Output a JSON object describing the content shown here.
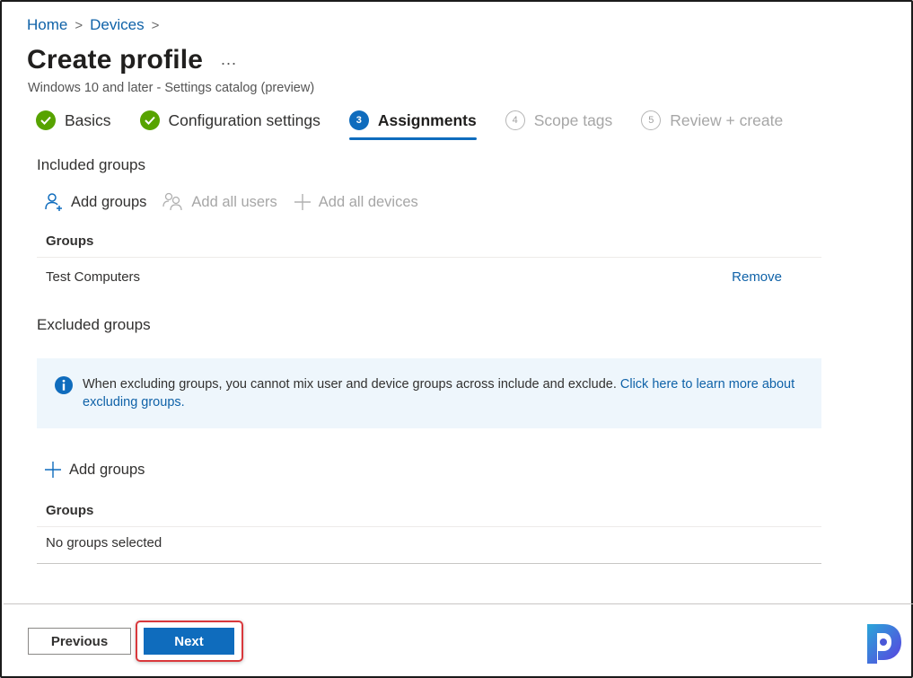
{
  "breadcrumb": [
    {
      "label": "Home"
    },
    {
      "label": "Devices"
    }
  ],
  "breadcrumb_separator": ">",
  "page": {
    "title": "Create profile",
    "more_label": "...",
    "subtitle": "Windows 10 and later - Settings catalog (preview)"
  },
  "wizard": {
    "steps": [
      {
        "number": "1",
        "label": "Basics",
        "state": "done"
      },
      {
        "number": "2",
        "label": "Configuration settings",
        "state": "done"
      },
      {
        "number": "3",
        "label": "Assignments",
        "state": "active"
      },
      {
        "number": "4",
        "label": "Scope tags",
        "state": "todo"
      },
      {
        "number": "5",
        "label": "Review + create",
        "state": "todo"
      }
    ]
  },
  "included": {
    "title": "Included groups",
    "commands": {
      "add_groups": "Add groups",
      "add_all_users": "Add all users",
      "add_all_devices": "Add all devices"
    },
    "table": {
      "header": "Groups",
      "rows": [
        {
          "name": "Test Computers",
          "action": "Remove"
        }
      ]
    }
  },
  "excluded": {
    "title": "Excluded groups",
    "info": {
      "text": "When excluding groups, you cannot mix user and device groups across include and exclude. ",
      "link": "Click here to learn more about excluding groups."
    },
    "add_groups": "Add groups",
    "table": {
      "header": "Groups",
      "empty": "No groups selected"
    }
  },
  "footer": {
    "previous": "Previous",
    "next": "Next"
  },
  "colors": {
    "accent": "#0f6cbd",
    "success": "#57a300",
    "link": "#0f62a8",
    "highlight": "#d9383c",
    "info_bg": "#eef6fc"
  }
}
